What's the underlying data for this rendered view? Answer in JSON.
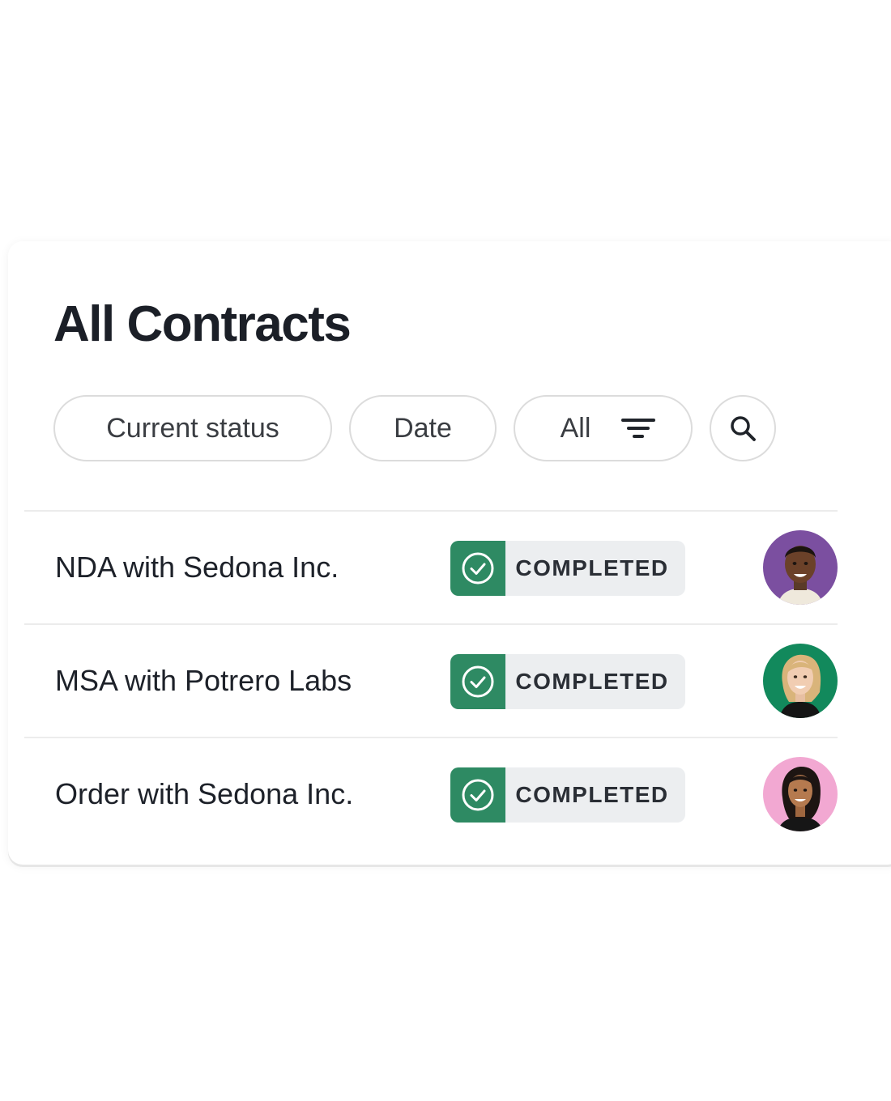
{
  "header": {
    "title": "All Contracts"
  },
  "filters": {
    "status_label": "Current status",
    "date_label": "Date",
    "all_label": "All",
    "filter_icon": "filter-lines-icon",
    "search_icon": "search-icon"
  },
  "contracts": [
    {
      "name": "NDA with Sedona Inc.",
      "status": "COMPLETED",
      "status_icon": "check-circle-icon",
      "avatar_bg": "#7b4fa0"
    },
    {
      "name": "MSA with Potrero Labs",
      "status": "COMPLETED",
      "status_icon": "check-circle-icon",
      "avatar_bg": "#12895c"
    },
    {
      "name": "Order with Sedona Inc.",
      "status": "COMPLETED",
      "status_icon": "check-circle-icon",
      "avatar_bg": "#f2a8d2"
    }
  ],
  "colors": {
    "status_green": "#2e8a63",
    "badge_bg": "#eceef0",
    "title": "#1b1f27"
  }
}
